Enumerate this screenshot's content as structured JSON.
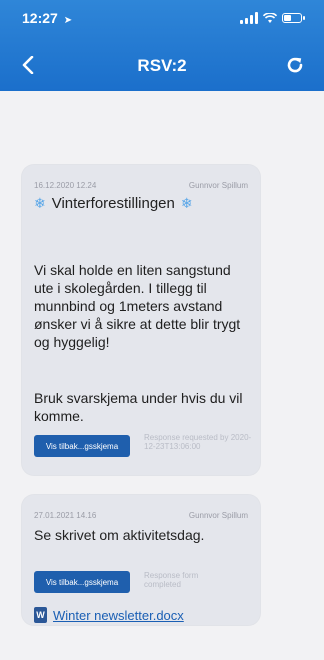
{
  "status_bar": {
    "time": "12:27",
    "location_icon": "location-arrow-icon",
    "signal_bars": 4,
    "battery_level": 0.4
  },
  "header": {
    "title": "RSV:2",
    "back_icon": "chevron-left-icon",
    "refresh_icon": "refresh-icon",
    "color": "#1b6fcb"
  },
  "messages": [
    {
      "date": "16.12.2020 12.24",
      "author": "Gunnvor Spillum",
      "title": "Vinterforestillingen",
      "title_icon": "snowflake-icon",
      "body": "Vi skal holde en liten sangstund ute i skolegården. I tillegg til munnbind og 1meters avstand ønsker vi å sikre at dette blir trygt og hyggelig!",
      "body2": "Bruk svarskjema under hvis du vil komme.",
      "button": "Vis tilbak...gsskjema",
      "status": "Response requested by 2020-12-23T13:06:00"
    },
    {
      "date": "27.01.2021 14.16",
      "author": "Gunnvor Spillum",
      "title": "Se skrivet om aktivitetsdag.",
      "button": "Vis tilbak...gsskjema",
      "status": "Response form completed",
      "attachment": "Winter newsletter.docx",
      "attachment_icon": "word-document-icon"
    }
  ]
}
